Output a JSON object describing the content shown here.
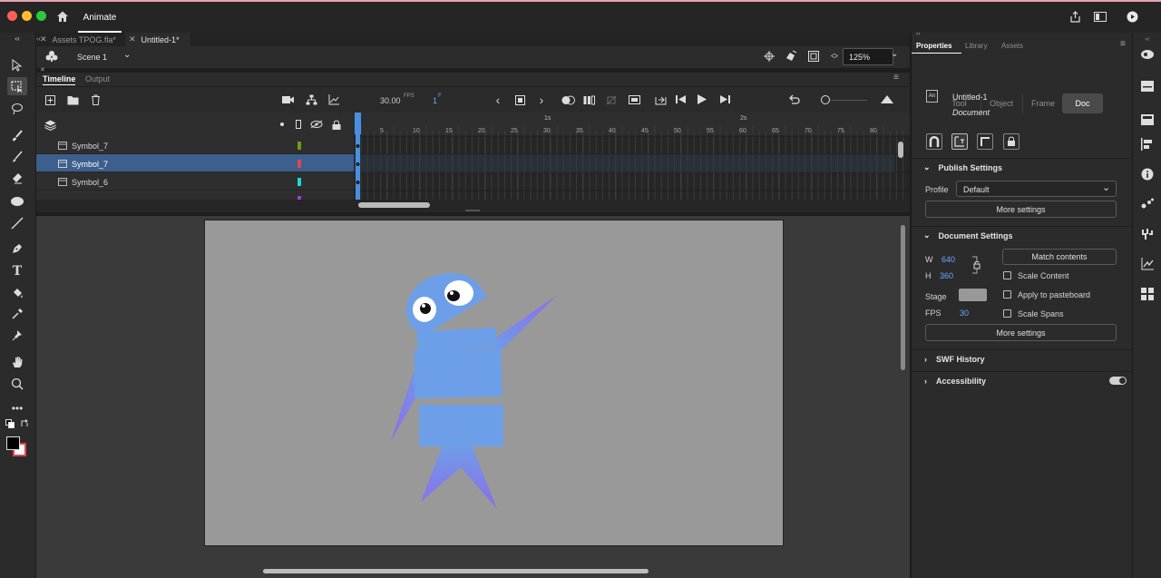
{
  "app": {
    "title": "Animate"
  },
  "doc_tabs": [
    {
      "label": "Assets TPOG.fla*"
    },
    {
      "label": "Untitled-1*"
    }
  ],
  "scene": {
    "label": "Scene 1",
    "zoom": "125%"
  },
  "timeline": {
    "tabs": [
      "Timeline",
      "Output"
    ],
    "fps": "30.00",
    "fps_unit": "FPS",
    "frame_indicator": "1",
    "frame_indicator_suffix": "F",
    "ruler_seconds": [
      "1s",
      "2s"
    ],
    "ruler_frames": [
      "5",
      "10",
      "15",
      "20",
      "25",
      "30",
      "35",
      "40",
      "45",
      "50",
      "55",
      "60",
      "65",
      "70",
      "75",
      "80"
    ],
    "layers": [
      {
        "name": "Symbol_7",
        "color": "#6e9c1a",
        "selected": false
      },
      {
        "name": "Symbol_7",
        "color": "#e0454d",
        "selected": true
      },
      {
        "name": "Symbol_6",
        "color": "#1fd6d6",
        "selected": false
      }
    ]
  },
  "properties": {
    "tabs": [
      "Properties",
      "Library",
      "Assets"
    ],
    "segments": [
      "Tool",
      "Object",
      "Frame",
      "Doc"
    ],
    "doc_name": "Untitled-1",
    "doc_type": "Document",
    "publish": {
      "title": "Publish Settings",
      "profile_label": "Profile",
      "profile_value": "Default",
      "more_settings": "More settings"
    },
    "document": {
      "title": "Document Settings",
      "w_label": "W",
      "w_value": "640",
      "h_label": "H",
      "h_value": "360",
      "match_contents": "Match contents",
      "scale_content": "Scale Content",
      "stage_label": "Stage",
      "stage_color": "#999999",
      "apply_pasteboard": "Apply to pasteboard",
      "fps_label": "FPS",
      "fps_value": "30",
      "scale_spans": "Scale Spans",
      "more_settings": "More settings"
    },
    "swf_history": "SWF History",
    "accessibility": "Accessibility"
  }
}
